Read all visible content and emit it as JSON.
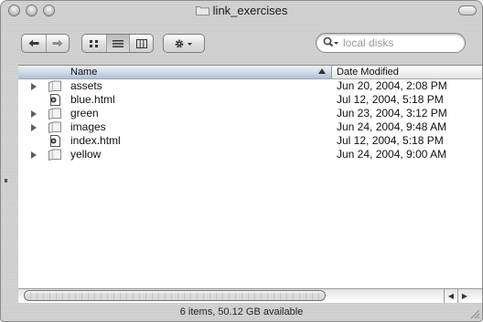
{
  "window": {
    "title": "link_exercises"
  },
  "toolbar": {
    "back_icon": "arrow-left-icon",
    "forward_icon": "arrow-right-icon",
    "views": [
      "icon-view-icon",
      "list-view-icon",
      "column-view-icon"
    ],
    "active_view": "list-view-icon",
    "action_icon": "gear-icon"
  },
  "search": {
    "placeholder": "local disks",
    "value": ""
  },
  "columns": {
    "name": "Name",
    "date": "Date Modified"
  },
  "files": [
    {
      "name": "assets",
      "date": "Jun 20, 2004, 2:08 PM",
      "kind": "folder"
    },
    {
      "name": "blue.html",
      "date": "Jul 12, 2004, 5:18 PM",
      "kind": "html"
    },
    {
      "name": "green",
      "date": "Jun 23, 2004, 3:12 PM",
      "kind": "folder"
    },
    {
      "name": "images",
      "date": "Jun 24, 2004, 9:48 AM",
      "kind": "folder"
    },
    {
      "name": "index.html",
      "date": "Jul 12, 2004, 5:18 PM",
      "kind": "html"
    },
    {
      "name": "yellow",
      "date": "Jun 24, 2004, 9:00 AM",
      "kind": "folder"
    }
  ],
  "status": {
    "text": "6 items, 50.12 GB available"
  },
  "colors": {
    "header_selected": "#aebfd6",
    "window_bg": "#d4d4d4"
  }
}
